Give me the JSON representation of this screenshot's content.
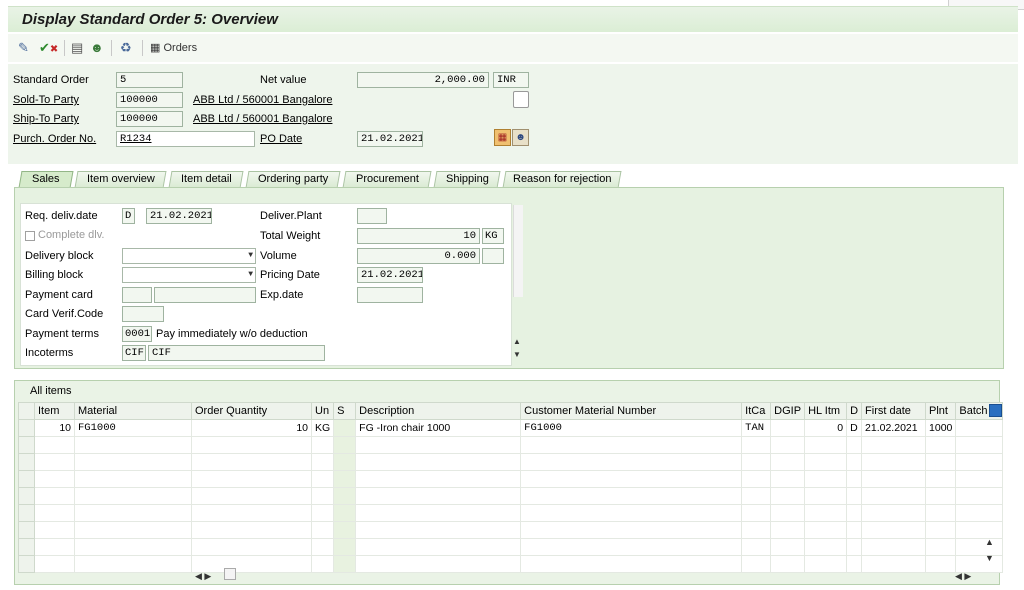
{
  "window": {
    "title": "Display Standard Order 5: Overview"
  },
  "toolbar": {
    "orders_label": "Orders"
  },
  "header": {
    "standard_order_label": "Standard Order",
    "standard_order_value": "5",
    "net_value_label": "Net value",
    "net_value_value": "2,000.00",
    "currency": "INR",
    "sold_to_label": "Sold-To Party",
    "sold_to_value": "100000",
    "sold_to_text": "ABB Ltd / 560001 Bangalore",
    "ship_to_label": "Ship-To Party",
    "ship_to_value": "100000",
    "ship_to_text": "ABB Ltd / 560001 Bangalore",
    "po_no_label": "Purch. Order No.",
    "po_no_value": "R1234",
    "po_date_label": "PO Date",
    "po_date_value": "21.02.2021"
  },
  "tabs": [
    "Sales",
    "Item overview",
    "Item detail",
    "Ordering party",
    "Procurement",
    "Shipping",
    "Reason for rejection"
  ],
  "sales": {
    "req_deliv_label": "Req. deliv.date",
    "req_deliv_type": "D",
    "req_deliv_value": "21.02.2021",
    "deliver_plant_label": "Deliver.Plant",
    "complete_dlv_label": "Complete dlv.",
    "total_weight_label": "Total Weight",
    "total_weight_value": "10",
    "weight_unit": "KG",
    "delivery_block_label": "Delivery block",
    "volume_label": "Volume",
    "volume_value": "0.000",
    "billing_block_label": "Billing block",
    "pricing_date_label": "Pricing Date",
    "pricing_date_value": "21.02.2021",
    "payment_card_label": "Payment card",
    "exp_date_label": "Exp.date",
    "card_verif_label": "Card Verif.Code",
    "payment_terms_label": "Payment terms",
    "payment_terms_code": "0001",
    "payment_terms_text": "Pay immediately w/o deduction",
    "incoterms_label": "Incoterms",
    "incoterms_code": "CIF",
    "incoterms_text": "CIF"
  },
  "items": {
    "title": "All items",
    "columns": [
      "Item",
      "Material",
      "Order Quantity",
      "Un",
      "S",
      "Description",
      "Customer Material Number",
      "ItCa",
      "DGIP",
      "HL Itm",
      "D",
      "First date",
      "Plnt",
      "Batch"
    ],
    "rows": [
      {
        "item": "10",
        "material": "FG1000",
        "qty": "10",
        "un": "KG",
        "s": "",
        "desc": "FG -Iron chair 1000",
        "cust_mat": "FG1000",
        "itca": "TAN",
        "dgip": "",
        "hl": "0",
        "d": "D",
        "first_date": "21.02.2021",
        "plnt": "1000",
        "batch": ""
      }
    ]
  }
}
